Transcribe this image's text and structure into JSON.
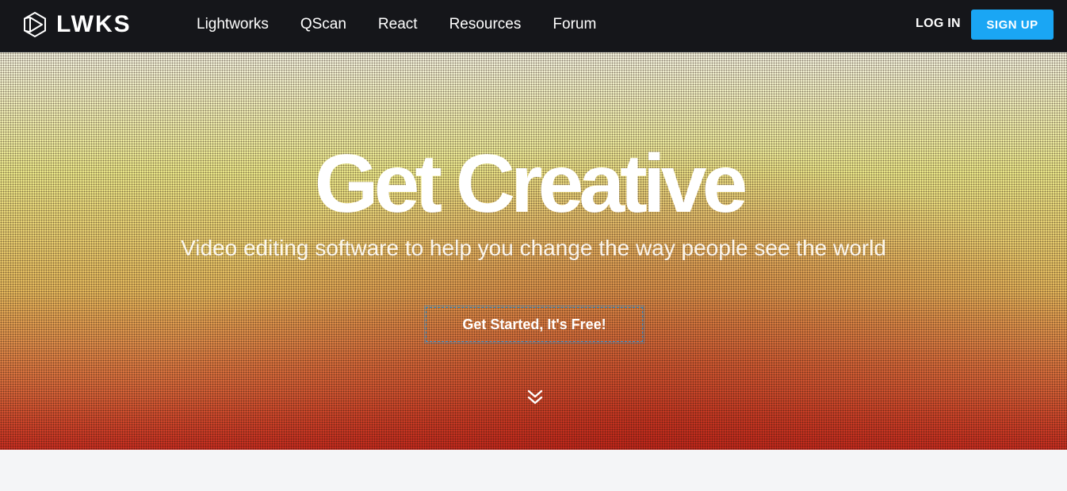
{
  "brand": {
    "name": "LWKS"
  },
  "nav": {
    "items": [
      {
        "label": "Lightworks"
      },
      {
        "label": "QScan"
      },
      {
        "label": "React"
      },
      {
        "label": "Resources"
      },
      {
        "label": "Forum"
      }
    ],
    "login_label": "LOG IN",
    "signup_label": "SIGN UP"
  },
  "hero": {
    "title": "Get Creative",
    "subtitle": "Video editing software to help you change the way people see the world",
    "cta_label": "Get Started, It's Free!",
    "scroll_icon": "double-chevron-down-icon"
  },
  "colors": {
    "nav_background": "#15161a",
    "signup_button": "#1aa6f4",
    "hero_top": "#fbfbe8",
    "hero_bottom": "#cf2d20",
    "page_background": "#f4f5f7"
  }
}
